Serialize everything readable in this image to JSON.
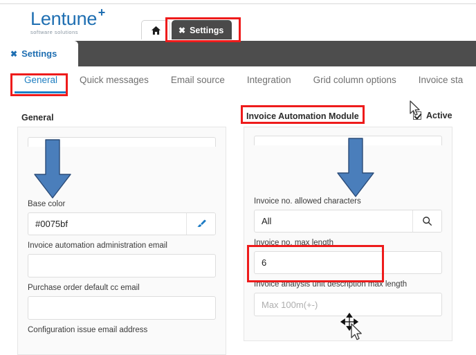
{
  "brand": {
    "name": "Lentune",
    "superscript": "+",
    "tagline": "software solutions"
  },
  "browser_tabs": {
    "home_icon": "home-icon",
    "active_tab": {
      "close_glyph": "✖",
      "label": "Settings"
    }
  },
  "page_tab": {
    "close_glyph": "✖",
    "label": "Settings"
  },
  "nav_tabs": [
    {
      "label": "General",
      "active": true
    },
    {
      "label": "Quick messages",
      "active": false
    },
    {
      "label": "Email source",
      "active": false
    },
    {
      "label": "Integration",
      "active": false
    },
    {
      "label": "Grid column options",
      "active": false
    },
    {
      "label": "Invoice sta",
      "active": false
    }
  ],
  "sections": {
    "left_heading": "General",
    "right_heading": "Invoice Automation Module",
    "active_checkbox_label": "Active"
  },
  "left_panel": {
    "fields": [
      {
        "label": "Base color",
        "value": "#0075bf",
        "placeholder": "",
        "addon_icon": "paintbrush-icon",
        "name": "base-color"
      },
      {
        "label": "Invoice automation administration email",
        "value": "",
        "placeholder": "",
        "addon_icon": "",
        "name": "invoice-automation-administration-email"
      },
      {
        "label": "Purchase order default cc email",
        "value": "",
        "placeholder": "",
        "addon_icon": "",
        "name": "purchase-order-default-cc-email"
      }
    ],
    "clipped_label": "Configuration issue email address"
  },
  "right_panel": {
    "fields": [
      {
        "label": "Invoice no. allowed characters",
        "value": "All",
        "placeholder": "",
        "addon_icon": "search-icon",
        "name": "invoice-no-allowed-characters"
      },
      {
        "label": "Invoice no. max length",
        "value": "6",
        "placeholder": "",
        "addon_icon": "",
        "name": "invoice-no-max-length"
      },
      {
        "label": "Invoice analysis unit description max length",
        "value": "",
        "placeholder": "Max 100m(+-)",
        "addon_icon": "",
        "name": "invoice-analysis-unit-description-max-length"
      }
    ]
  },
  "annotations": {
    "highlight_color": "#ee1b1b",
    "arrow_color": "#4a7ebb",
    "arrows": [
      {
        "name": "arrow-down-left",
        "points_to": "Base color field"
      },
      {
        "name": "arrow-down-right",
        "points_to": "Invoice no. fields"
      }
    ],
    "red_boxes": [
      {
        "name": "settings-browser-tab"
      },
      {
        "name": "general-nav-tab"
      },
      {
        "name": "invoice-automation-module-heading"
      },
      {
        "name": "invoice-no-max-length-field"
      }
    ]
  },
  "colors": {
    "brand_blue": "#1f6fb2",
    "accent_blue": "#1b82c9",
    "dark_bar": "#4d4d4d",
    "panel_bg": "#fafafa",
    "base_color_value": "#0075bf"
  }
}
